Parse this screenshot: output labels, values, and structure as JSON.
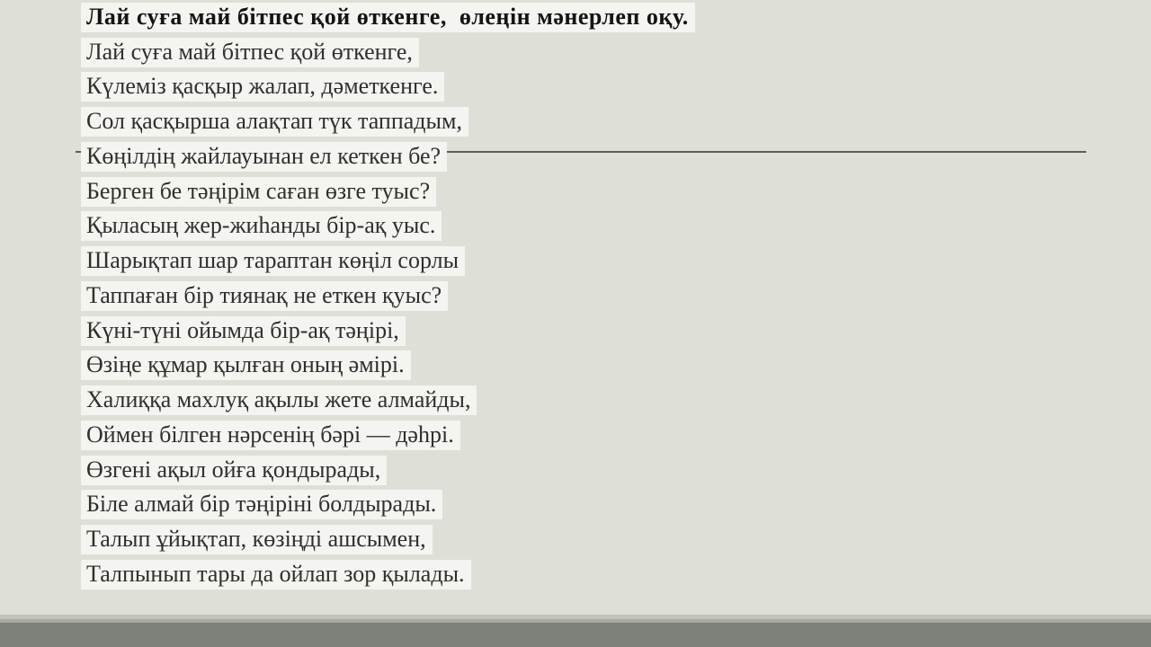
{
  "slide": {
    "title": "Лай суға май бітпес қой өткенге,  өлеңін мәнерлеп оқу.",
    "lines": [
      "Лай суға май бітпес қой өткенге,",
      "Күлеміз қасқыр жалап, дәметкенге.",
      "Сол қасқырша алақтап түк таппадым,",
      "Көңілдің жайлауынан ел кеткен бе?",
      "Берген бе тәңірім саған өзге туыс?",
      "Қыласың жер-жиһанды бір-ақ уыс.",
      "Шарықтап шар тараптан көңіл сорлы",
      "Таппаған бір тиянақ не еткен қуыс?",
      "Күні-түні ойымда бір-ақ тәңірі,",
      "Өзіңе құмар қылған оның әмірі.",
      "Халиққа махлуқ ақылы жете алмайды,",
      "Оймен білген нәрсенің бәрі — дәһрі.",
      "Өзгені ақыл ойға қондырады,",
      "Біле алмай бір тәңіріні болдырады.",
      "Талып ұйықтап, көзіңді ашсымен,",
      "Талпынып тары да ойлап зор қылады."
    ]
  },
  "colors": {
    "slide_bg": "#dedfd7",
    "highlight": "#f4f5f1",
    "text": "#2f2f2b",
    "title_text": "#141412",
    "divider": "#5c5e58",
    "footer_strip1": "#c2c4bc",
    "footer_strip2": "#a9aba3",
    "footer_bar": "#7e807a"
  }
}
